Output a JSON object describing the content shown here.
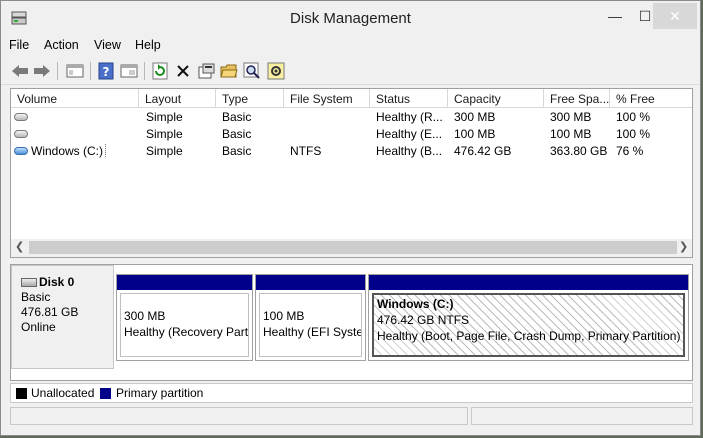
{
  "window": {
    "title": "Disk Management"
  },
  "menu": [
    "File",
    "Action",
    "View",
    "Help"
  ],
  "toolbar": {
    "icons": [
      "back-arrow-icon",
      "forward-arrow-icon",
      "show-hide-console-tree-icon",
      "help-icon",
      "properties-view-icon",
      "refresh-icon",
      "delete-icon",
      "properties-icon",
      "open-icon",
      "explore-icon",
      "settings-icon"
    ]
  },
  "table": {
    "columns": [
      "Volume",
      "Layout",
      "Type",
      "File System",
      "Status",
      "Capacity",
      "Free Spa...",
      "% Free"
    ],
    "rows": [
      {
        "volume": "",
        "layout": "Simple",
        "type": "Basic",
        "fs": "",
        "status": "Healthy (R...",
        "capacity": "300 MB",
        "free": "300 MB",
        "pct": "100 %"
      },
      {
        "volume": "",
        "layout": "Simple",
        "type": "Basic",
        "fs": "",
        "status": "Healthy (E...",
        "capacity": "100 MB",
        "free": "100 MB",
        "pct": "100 %"
      },
      {
        "volume": "Windows (C:)",
        "layout": "Simple",
        "type": "Basic",
        "fs": "NTFS",
        "status": "Healthy (B...",
        "capacity": "476.42 GB",
        "free": "363.80 GB",
        "pct": "76 %"
      }
    ]
  },
  "disk": {
    "name": "Disk 0",
    "type": "Basic",
    "size": "476.81 GB",
    "state": "Online",
    "partitions": [
      {
        "name": "",
        "size": "300 MB",
        "status": "Healthy (Recovery Parti"
      },
      {
        "name": "",
        "size": "100 MB",
        "status": "Healthy (EFI Syster"
      },
      {
        "name": "Windows  (C:)",
        "size": "476.42 GB NTFS",
        "status": "Healthy (Boot, Page File, Crash Dump, Primary Partition)"
      }
    ]
  },
  "legend": [
    {
      "label": "Unallocated",
      "color": "#000000"
    },
    {
      "label": "Primary partition",
      "color": "#00008b"
    }
  ]
}
